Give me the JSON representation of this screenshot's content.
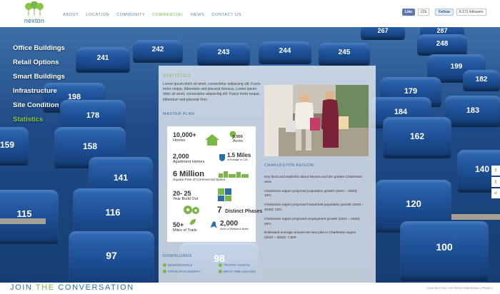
{
  "header": {
    "logo_text": "nexton",
    "nav": [
      {
        "label": "ABOUT",
        "active": false
      },
      {
        "label": "LOCATION",
        "active": false
      },
      {
        "label": "COMMUNITY",
        "active": false
      },
      {
        "label": "COMMERCIAL",
        "active": true
      },
      {
        "label": "NEWS",
        "active": false
      },
      {
        "label": "CONTACT US",
        "active": false
      }
    ],
    "social": {
      "fb_like": "Like",
      "fb_count": "22k",
      "tw_follow": "Follow",
      "tw_count": "8,171 followers"
    }
  },
  "side_menu": [
    {
      "label": "Office Buildings",
      "active": false
    },
    {
      "label": "Retail Options",
      "active": false
    },
    {
      "label": "Smart Buildings",
      "active": false
    },
    {
      "label": "Infrastructure",
      "active": false
    },
    {
      "label": "Site Condition",
      "active": false
    },
    {
      "label": "Statistics",
      "active": true
    }
  ],
  "panel": {
    "title": "STATISTICS",
    "lorem": "Lorem ipsum dolor sit amet, consectetur adipiscing elit. Fusce tortor neque, bibendum sed placerat rhoncus. Lorem ipsum dolor sit amet, consectetur adipiscing elit. Fusce tortor neque, bibendum sed placerat rhon",
    "master_plan_label": "MASTER PLAN",
    "master_plan": {
      "homes_value": "10,000+",
      "homes_label": "Homes",
      "acres_value": "5,000",
      "acres_label": "Acres",
      "apartments_value": "2,000",
      "apartments_label": "Apartment Homes",
      "frontage_value": "1.5 Miles",
      "frontage_label": "of frontage on I-26",
      "commercial_value": "6 Million",
      "commercial_label": "Square Feet of Commercial Space",
      "buildout_value": "20- 25",
      "buildout_label": "Year Build Out",
      "phases_value": "7",
      "phases_label": "Distinct Phases",
      "trails_value": "50+",
      "trails_label": "Miles of Trails",
      "wetland_value": "2,000",
      "wetland_label": "Acres of Wetland & Buffer"
    },
    "region_label": "CHARLESTON REGION",
    "region_paragraphs": [
      "Key facts and statistics about Nexton and the greater Charleston area.",
      "Charleston region projected population growth (2010 – 2020): 18%",
      "Charleston region projected household population growth (2010 – 2020): 23%",
      "Charleston region projected employment growth (2010 – 2020): 25%",
      "Estimated average annual net new jobs in Charleston region (2010 – 2020): 7,500"
    ],
    "downloads_label": "DOWNLOADS",
    "downloads": [
      "DEMOGRAPHICS",
      "TRAFFIC COUNTS",
      "POPULATION DENSITY",
      "DRIVE TIME ANALYSIS"
    ]
  },
  "seats": [
    {
      "num": "267"
    },
    {
      "num": "287"
    },
    {
      "num": "248"
    },
    {
      "num": "242"
    },
    {
      "num": "243"
    },
    {
      "num": "244"
    },
    {
      "num": "245"
    },
    {
      "num": "241"
    },
    {
      "num": "199"
    },
    {
      "num": "198"
    },
    {
      "num": "179"
    },
    {
      "num": "178"
    },
    {
      "num": "184"
    },
    {
      "num": "183"
    },
    {
      "num": "182"
    },
    {
      "num": "159"
    },
    {
      "num": "158"
    },
    {
      "num": "162"
    },
    {
      "num": "141"
    },
    {
      "num": "140"
    },
    {
      "num": "115"
    },
    {
      "num": "116"
    },
    {
      "num": "120"
    },
    {
      "num": "97"
    },
    {
      "num": "98"
    },
    {
      "num": "100"
    }
  ],
  "footer": {
    "join_prefix": "JOIN ",
    "join_highlight": "THE",
    "join_suffix": " CONVERSATION",
    "copyright": "©2013 NEXTON  |  COPYRIGHT/TRADEMARK  |  PRIVACY"
  },
  "colors": {
    "accent_green": "#7ab648",
    "brand_blue": "#2e6ea6",
    "seat_blue": "#1b4d92"
  }
}
